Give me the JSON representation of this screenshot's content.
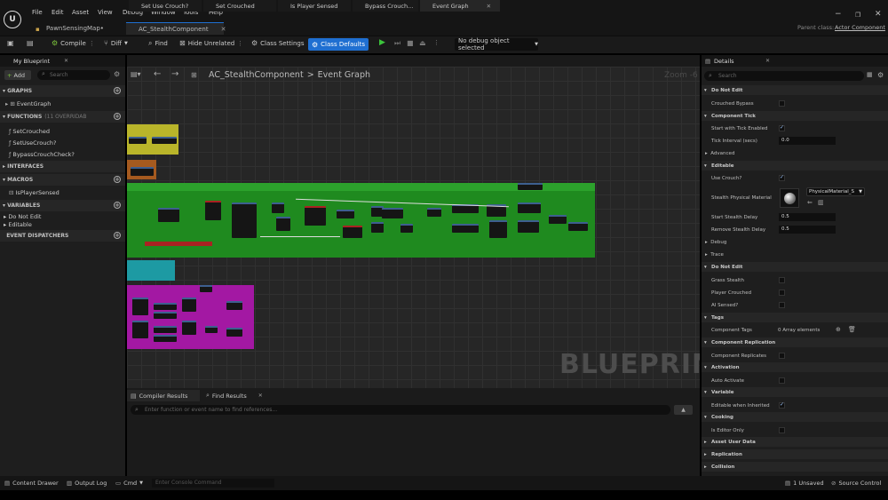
{
  "menu": [
    "File",
    "Edit",
    "Asset",
    "View",
    "Debug",
    "Window",
    "Tools",
    "Help"
  ],
  "tabs": [
    "PawnSensingMap•",
    "AC_StealthComponent"
  ],
  "parent_class_label": "Parent class:",
  "parent_class_value": "Actor Component",
  "toolbar": {
    "compile": "Compile",
    "diff": "Diff",
    "find": "Find",
    "hide_unrelated": "Hide Unrelated",
    "class_settings": "Class Settings",
    "class_defaults": "Class Defaults",
    "debug_object": "No debug object selected"
  },
  "left": {
    "title": "My Blueprint",
    "add": "Add",
    "search_placeholder": "Search",
    "graphs_header": "GRAPHS",
    "event_graph": "EventGraph",
    "functions_header": "FUNCTIONS",
    "functions_override": "(11 OVERRIDAB",
    "functions": [
      "SetCrouched",
      "SetUseCrouch?",
      "BypassCrouchCheck?"
    ],
    "interfaces_header": "INTERFACES",
    "macros_header": "MACROS",
    "macros": [
      "IsPlayerSensed"
    ],
    "variables_header": "VARIABLES",
    "variables": [
      "Do Not Edit",
      "Editable"
    ],
    "dispatchers_header": "EVENT DISPATCHERS"
  },
  "graph": {
    "tabs": [
      "Set Use Crouch?",
      "Set Crouched",
      "Is Player Sensed",
      "Bypass Crouch...",
      "Event Graph"
    ],
    "breadcrumb_root": "AC_StealthComponent",
    "breadcrumb_sep": ">",
    "breadcrumb_current": "Event Graph",
    "zoom": "Zoom -6",
    "watermark": "BLUEPRINT"
  },
  "bottom": {
    "tabs": [
      "Compiler Results",
      "Find Results"
    ],
    "search_placeholder": "Enter function or event name to find references..."
  },
  "details": {
    "title": "Details",
    "search_placeholder": "Search",
    "sections": {
      "do_not_edit_1": "Do Not Edit",
      "component_tick": "Component Tick",
      "advanced": "Advanced",
      "editable": "Editable",
      "debug": "Debug",
      "trace": "Trace",
      "do_not_edit_2": "Do Not Edit",
      "tags": "Tags",
      "component_replication": "Component Replication",
      "activation": "Activation",
      "variable": "Variable",
      "cooking": "Cooking",
      "asset_user_data": "Asset User Data",
      "replication": "Replication",
      "collision": "Collision"
    },
    "rows": {
      "crouched_bypass": "Crouched Bypass",
      "start_tick": "Start with Tick Enabled",
      "tick_interval": "Tick Interval (secs)",
      "tick_interval_value": "0.0",
      "use_crouch": "Use Crouch?",
      "stealth_material": "Stealth Physical Material",
      "stealth_material_value": "PhysicalMaterial_S",
      "start_delay": "Start Stealth Delay",
      "start_delay_value": "0.5",
      "remove_delay": "Remove Stealth Delay",
      "remove_delay_value": "0.5",
      "grass_stealth": "Grass Stealth",
      "player_crouched": "Player Crouched",
      "ai_sensed": "AI Sensed?",
      "component_tags": "Component Tags",
      "component_tags_value": "0 Array elements",
      "component_replicates": "Component Replicates",
      "auto_activate": "Auto Activate",
      "editable_inherited": "Editable when Inherited",
      "is_editor_only": "Is Editor Only"
    }
  },
  "status": {
    "content_drawer": "Content Drawer",
    "output_log": "Output Log",
    "cmd": "Cmd",
    "console_placeholder": "Enter Console Command",
    "unsaved": "1 Unsaved",
    "source_control": "Source Control"
  },
  "colors": {
    "accent": "#1f6fd1",
    "comment_yellow": "#b9b52a",
    "comment_green": "#1f8a1f",
    "comment_teal": "#1d9aa3",
    "comment_magenta": "#a318a3",
    "comment_orange": "#a55a1f"
  }
}
